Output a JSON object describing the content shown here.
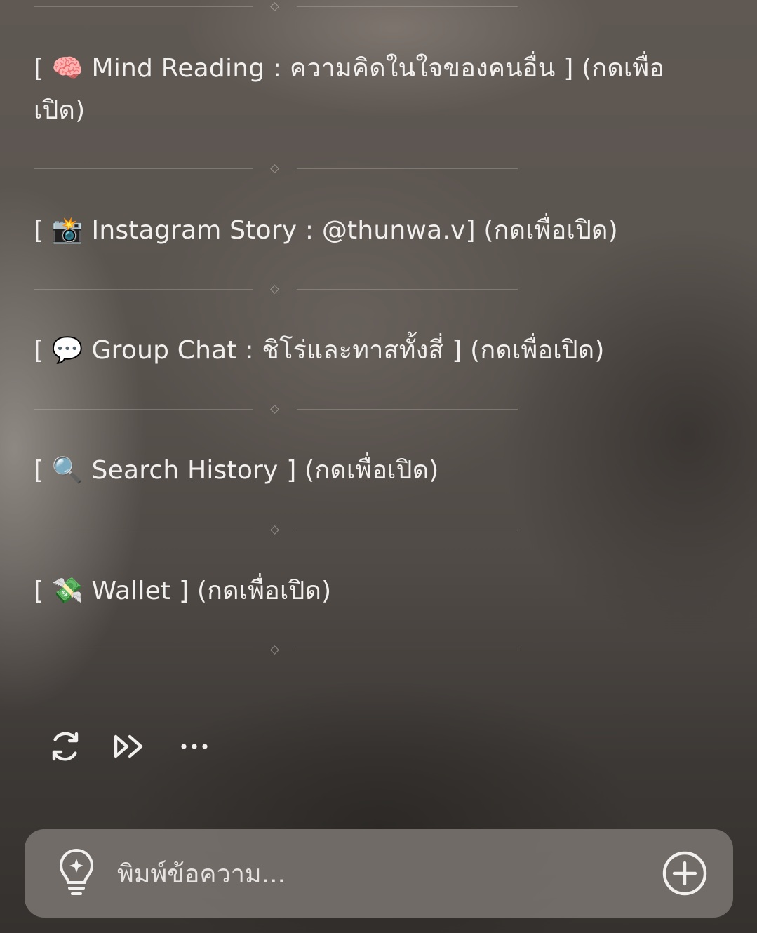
{
  "menu_items": [
    {
      "label": "[ 🧠 Mind Reading : ความคิดในใจของคนอื่น ] (กดเพื่อเปิด)"
    },
    {
      "label": "[ 📸 Instagram Story : @thunwa.v] (กดเพื่อเปิด)"
    },
    {
      "label": "[ 💬 Group Chat : ชิโร่และทาสทั้งสี่ ] (กดเพื่อเปิด)"
    },
    {
      "label": "[ 🔍 Search History ] (กดเพื่อเปิด)"
    },
    {
      "label": "[ 💸 Wallet ] (กดเพื่อเปิด)"
    }
  ],
  "actions": {
    "regenerate_icon": "refresh-icon",
    "continue_icon": "fast-forward-icon",
    "more_icon": "more-icon"
  },
  "composer": {
    "placeholder": "พิมพ์ข้อความ...",
    "hint_icon": "lightbulb-icon",
    "add_icon": "plus-circle-icon"
  },
  "colors": {
    "text": "#f2f0ee",
    "input_bar": "#76716c"
  }
}
